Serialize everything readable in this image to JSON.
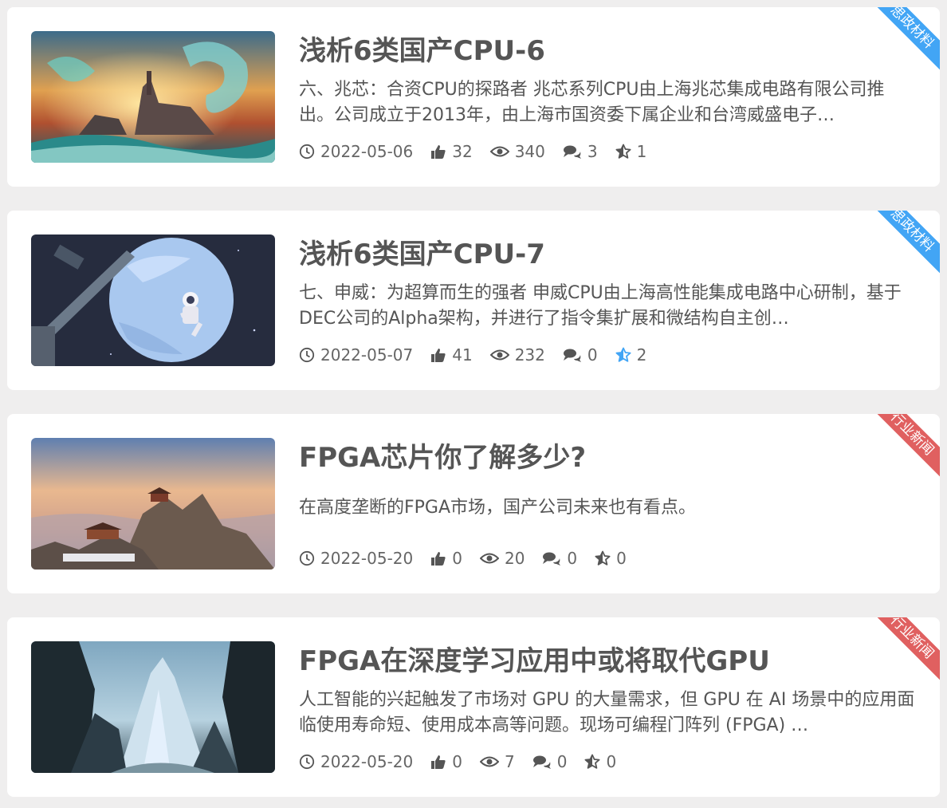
{
  "colors": {
    "ribbon_blue": "#42a5f5",
    "ribbon_red": "#e06060",
    "star_active": "#42a5f5"
  },
  "articles": [
    {
      "title": "浅析6类国产CPU-6",
      "desc": "六、兆芯：合资CPU的探路者 兆芯系列CPU由上海兆芯集成电路有限公司推出。公司成立于2013年，由上海市国资委下属企业和台湾威盛电子…",
      "date": "2022-05-06",
      "likes": "32",
      "views": "340",
      "comments": "3",
      "favorites": "1",
      "tag": "思政材料",
      "tag_color": "#42a5f5",
      "favorited": false
    },
    {
      "title": "浅析6类国产CPU-7",
      "desc": "七、申威：为超算而生的强者 申威CPU由上海高性能集成电路中心研制，基于DEC公司的Alpha架构，并进行了指令集扩展和微结构自主创…",
      "date": "2022-05-07",
      "likes": "41",
      "views": "232",
      "comments": "0",
      "favorites": "2",
      "tag": "思政材料",
      "tag_color": "#42a5f5",
      "favorited": true
    },
    {
      "title": "FPGA芯片你了解多少?",
      "desc": "在高度垄断的FPGA市场，国产公司未来也有看点。",
      "date": "2022-05-20",
      "likes": "0",
      "views": "20",
      "comments": "0",
      "favorites": "0",
      "tag": "行业新闻",
      "tag_color": "#e06060",
      "favorited": false
    },
    {
      "title": "FPGA在深度学习应用中或将取代GPU",
      "desc": "人工智能的兴起触发了市场对 GPU 的大量需求，但 GPU 在 AI 场景中的应用面临使用寿命短、使用成本高等问题。现场可编程门阵列 (FPGA) …",
      "date": "2022-05-20",
      "likes": "0",
      "views": "7",
      "comments": "0",
      "favorites": "0",
      "tag": "行业新闻",
      "tag_color": "#e06060",
      "favorited": false
    }
  ]
}
